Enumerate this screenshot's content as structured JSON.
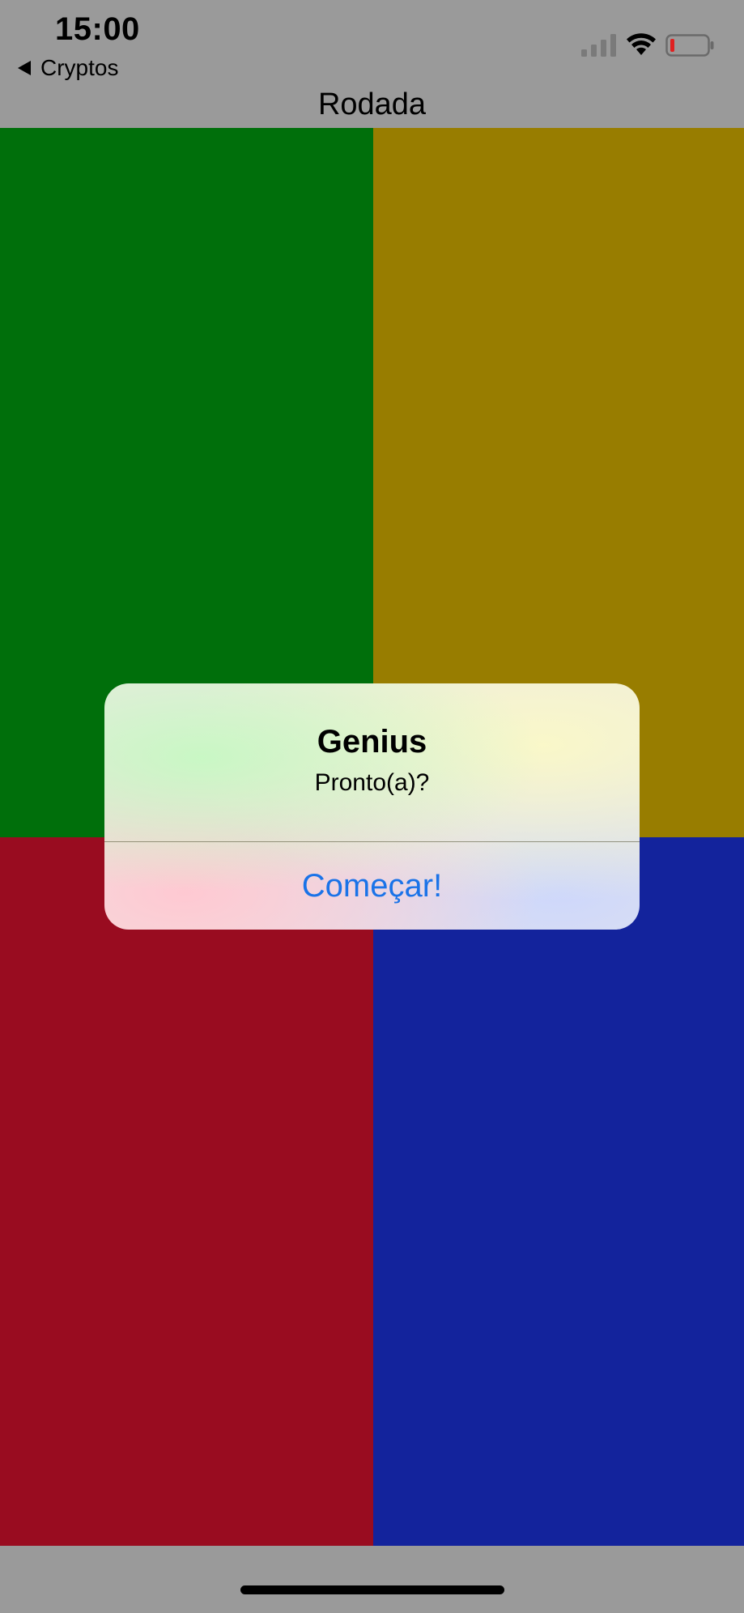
{
  "status_bar": {
    "time": "15:00",
    "icons": [
      "cellular-signal-icon",
      "wifi-icon",
      "battery-low-icon"
    ]
  },
  "navigation": {
    "back_label": "Cryptos",
    "title": "Rodada"
  },
  "board": {
    "colors": {
      "green": "#006f0b",
      "yellow": "#987d00",
      "red": "#990c20",
      "blue": "#13239c"
    }
  },
  "alert": {
    "title": "Genius",
    "message": "Pronto(a)?",
    "button_label": "Começar!",
    "button_color": "#1a73e8"
  }
}
